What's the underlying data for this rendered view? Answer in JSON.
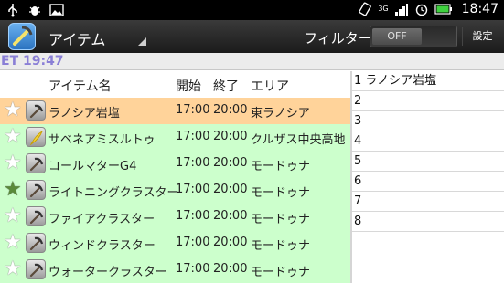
{
  "status_bar": {
    "time": "18:47",
    "network_label": "3G",
    "icons_left": [
      "usb-icon",
      "debug-icon",
      "image-icon"
    ],
    "icons_right": [
      "rotate-icon",
      "signal-icon",
      "alarm-icon",
      "battery-icon"
    ]
  },
  "action_bar": {
    "title": "アイテム",
    "filter_label": "フィルター",
    "toggle_state": "OFF",
    "settings_label": "設定"
  },
  "et_bar": {
    "text": "ET  19:47",
    "color": "#8a7fd6"
  },
  "table": {
    "headers": {
      "name": "アイテム名",
      "start": "開始",
      "end": "終了",
      "area": "エリア"
    },
    "rows": [
      {
        "name": "ラノシア岩塩",
        "start": "17:00",
        "end": "20:00",
        "area": "東ラノシア",
        "starred": false,
        "tool": "pickaxe-icon",
        "highlighted": true
      },
      {
        "name": "サベネアミスルトゥ",
        "start": "17:00",
        "end": "20:00",
        "area": "クルザス中央高地",
        "starred": false,
        "tool": "hatchet-icon",
        "highlighted": false
      },
      {
        "name": "コールマターG4",
        "start": "17:00",
        "end": "20:00",
        "area": "モードゥナ",
        "starred": false,
        "tool": "pickaxe-icon",
        "highlighted": false
      },
      {
        "name": "ライトニングクラスター",
        "start": "17:00",
        "end": "20:00",
        "area": "モードゥナ",
        "starred": true,
        "tool": "pickaxe-icon",
        "highlighted": false
      },
      {
        "name": "ファイアクラスター",
        "start": "17:00",
        "end": "20:00",
        "area": "モードゥナ",
        "starred": false,
        "tool": "pickaxe-icon",
        "highlighted": false
      },
      {
        "name": "ウィンドクラスター",
        "start": "17:00",
        "end": "20:00",
        "area": "モードゥナ",
        "starred": false,
        "tool": "pickaxe-icon",
        "highlighted": false
      },
      {
        "name": "ウォータークラスター",
        "start": "17:00",
        "end": "20:00",
        "area": "モードゥナ",
        "starred": false,
        "tool": "pickaxe-icon",
        "highlighted": false
      }
    ],
    "row_color": "#ccffcc",
    "highlight_color": "#ffd39a"
  },
  "right_list": [
    "1 ラノシア岩塩",
    "2",
    "3",
    "4",
    "5",
    "6",
    "7",
    "8"
  ]
}
